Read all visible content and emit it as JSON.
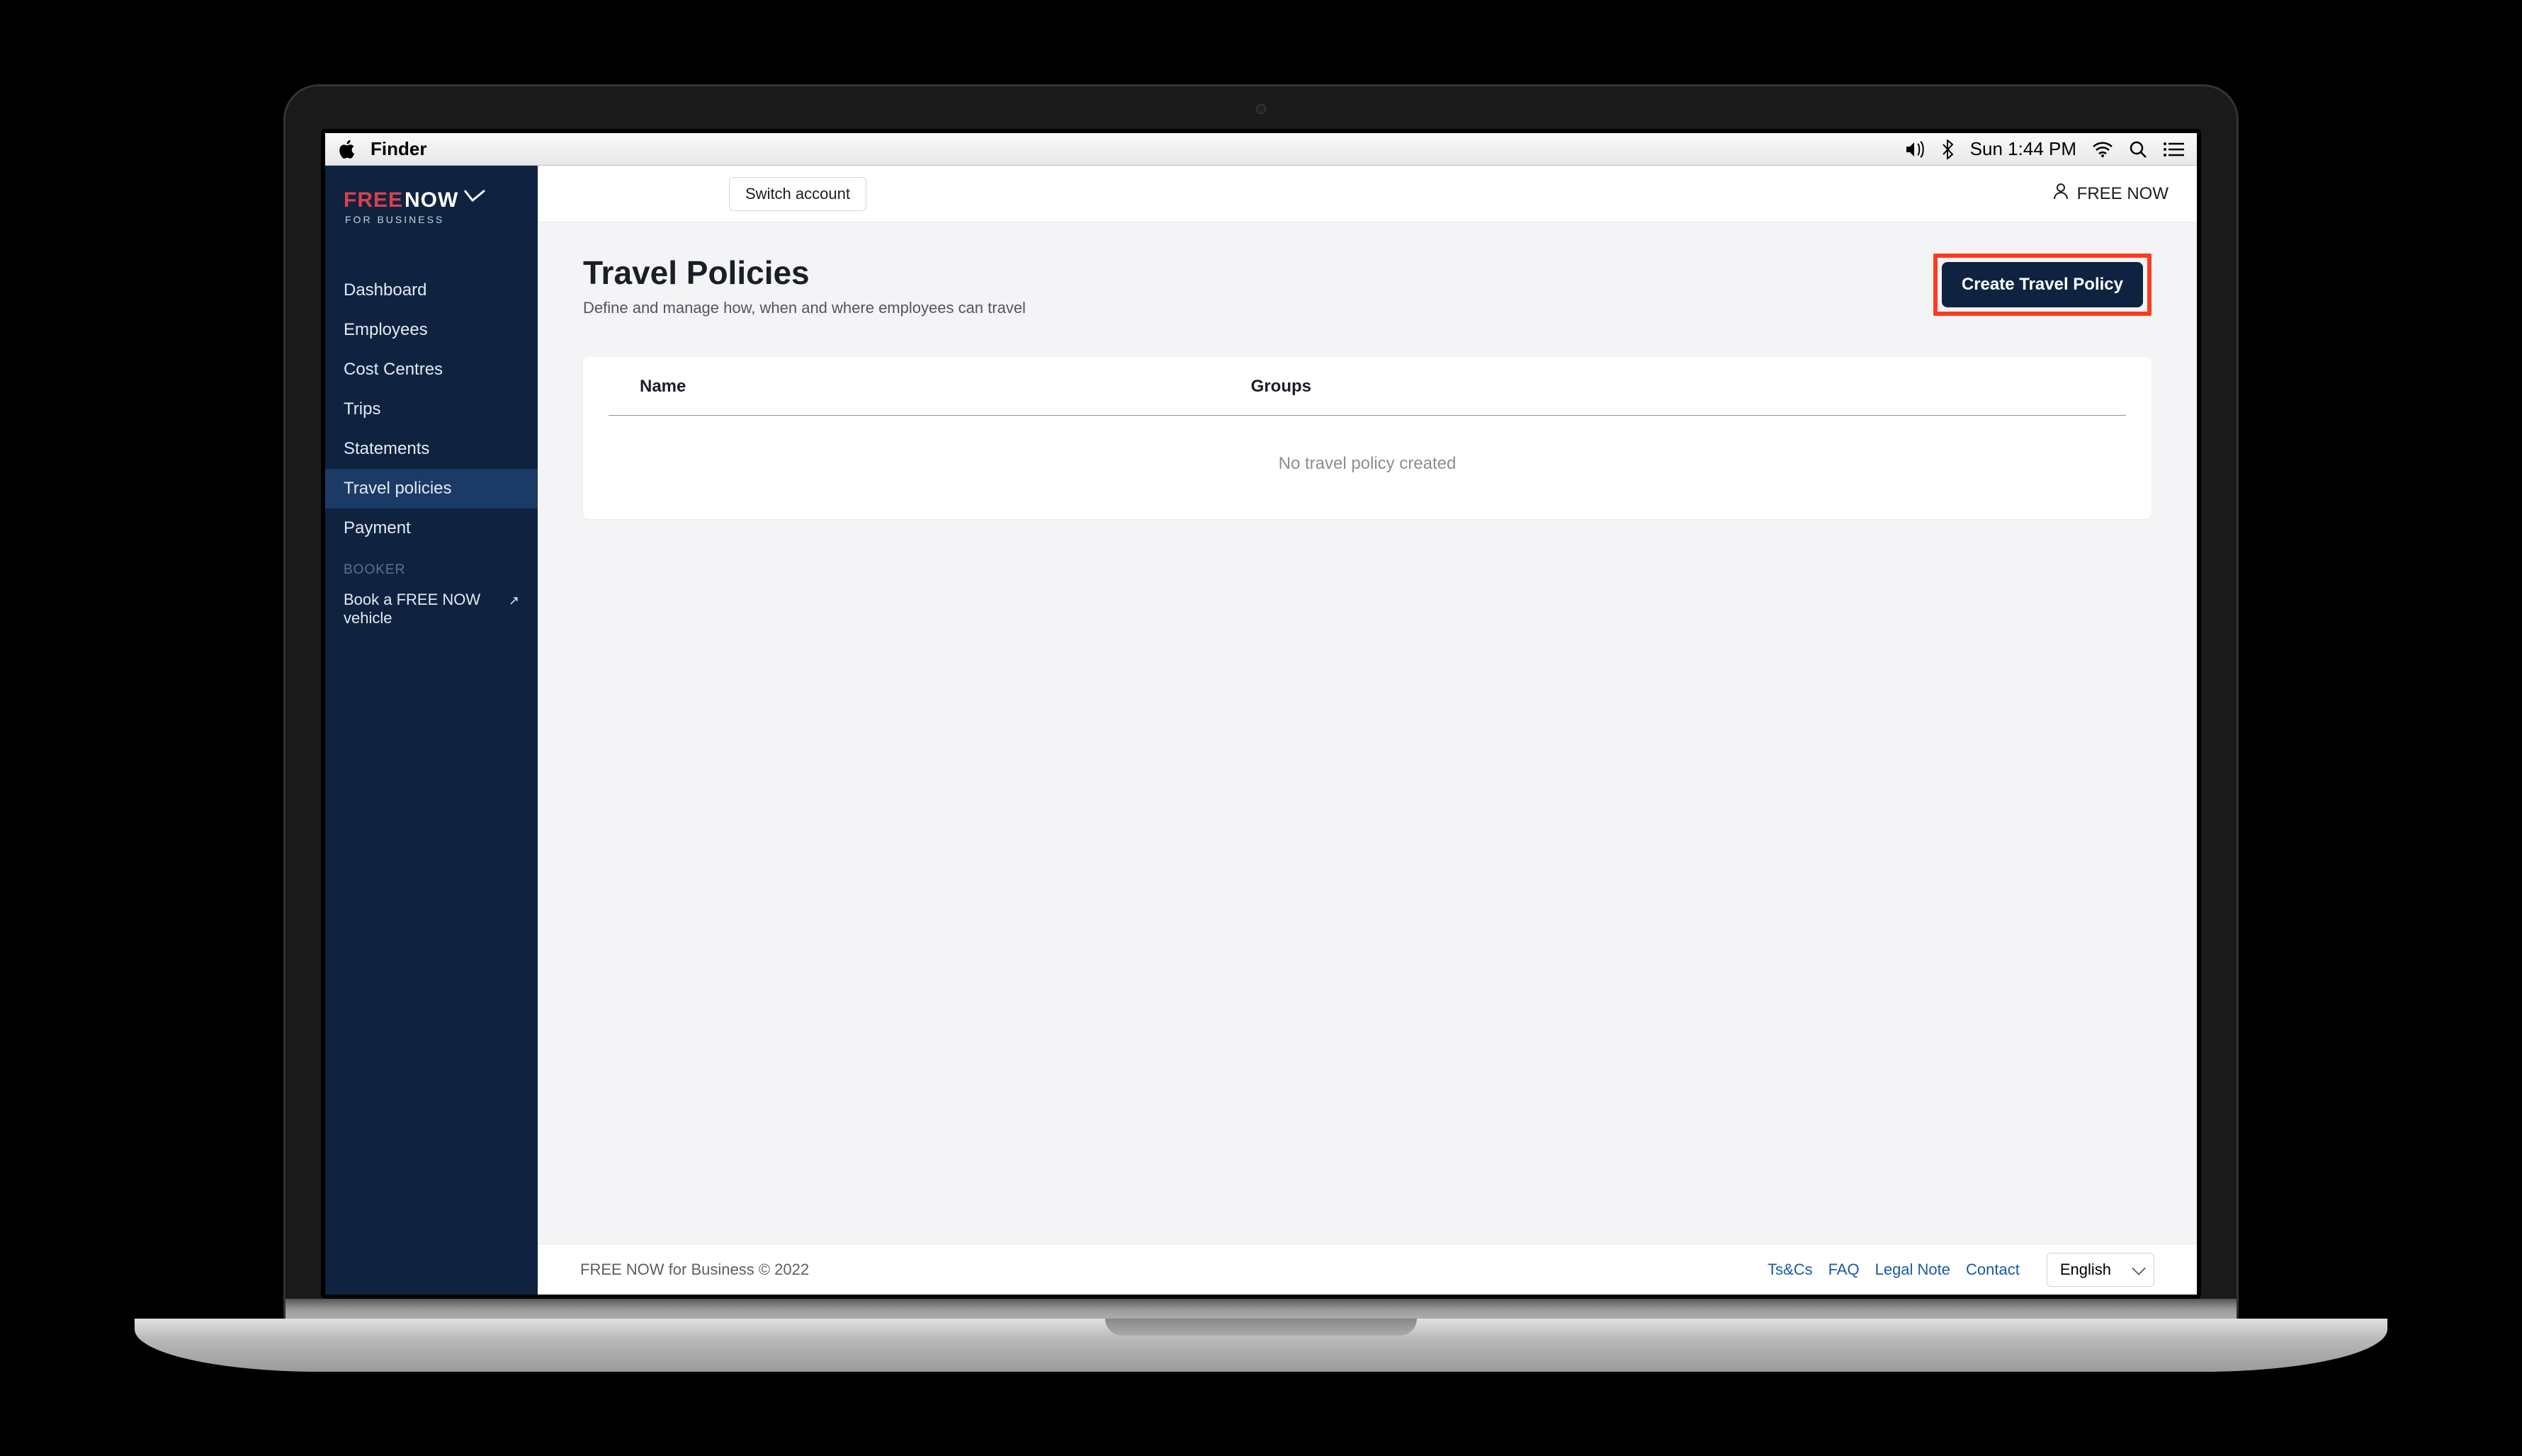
{
  "mac_menu": {
    "app": "Finder",
    "time": "Sun 1:44 PM"
  },
  "brand": {
    "free": "FREE",
    "now": "NOW",
    "sub": "FOR BUSINESS"
  },
  "sidebar": {
    "items": [
      {
        "label": "Dashboard"
      },
      {
        "label": "Employees"
      },
      {
        "label": "Cost Centres"
      },
      {
        "label": "Trips"
      },
      {
        "label": "Statements"
      },
      {
        "label": "Travel policies"
      },
      {
        "label": "Payment"
      }
    ],
    "booker_title": "BOOKER",
    "book_label": "Book a FREE NOW vehicle"
  },
  "topbar": {
    "switch_label": "Switch account",
    "account_label": "FREE NOW"
  },
  "page": {
    "title": "Travel Policies",
    "subtitle": "Define and manage how, when and where employees can travel",
    "create_label": "Create Travel Policy"
  },
  "table": {
    "cols": {
      "name": "Name",
      "groups": "Groups"
    },
    "empty": "No travel policy created"
  },
  "footer": {
    "copyright": "FREE NOW for Business © 2022",
    "links": {
      "ts": "Ts&Cs",
      "faq": "FAQ",
      "legal": "Legal Note",
      "contact": "Contact"
    },
    "lang": "English"
  }
}
